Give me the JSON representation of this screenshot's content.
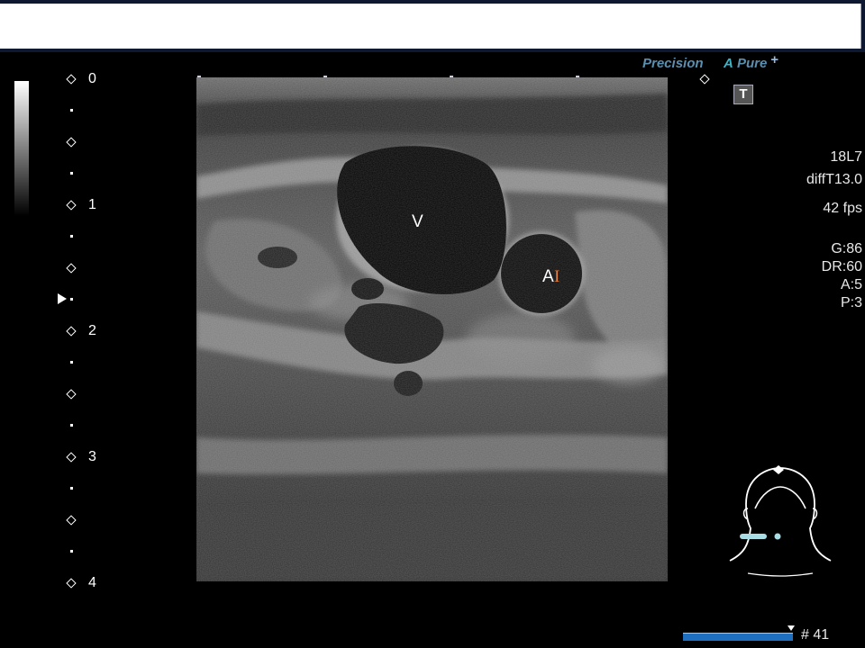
{
  "header": {
    "field_value": ""
  },
  "depth_scale": {
    "labels": [
      "0",
      "1",
      "2",
      "3",
      "4"
    ],
    "unit": "cm",
    "focus_depth_cm": 1.75
  },
  "brand": {
    "precision": "Precision",
    "a": "A",
    "pure": "Pure",
    "plus": "+"
  },
  "toolbar": {
    "t_button_label": "T"
  },
  "params": {
    "transducer": "18L7",
    "mode": "diffT13.0",
    "frame_rate": "42 fps",
    "gain": "G:86",
    "dynamic_range": "DR:60",
    "a": "A:5",
    "p": "P:3"
  },
  "annotations": {
    "vein": "V",
    "artery": "A",
    "cursor": "I"
  },
  "cine": {
    "frame": "# 41",
    "bar_color": "#1f6fc0"
  },
  "colors": {
    "background": "#000000",
    "header": "#0e1830",
    "brand_blue": "#5b8fb0",
    "brand_cyan": "#3fb3c8",
    "probe_marker": "#a8dde6",
    "cursor": "#e07a3a"
  },
  "icons": {
    "pictogram": "neck-body-marker-icon",
    "t_button": "text-tool-icon"
  }
}
